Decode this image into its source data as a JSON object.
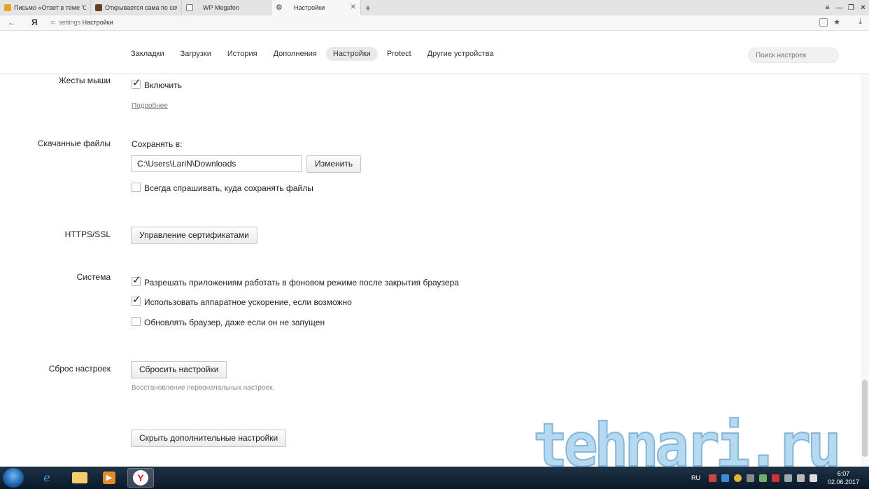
{
  "tabs": [
    {
      "title": "Письмо «Ответ в теме 'Отв",
      "favicon_color": "#e8a12a"
    },
    {
      "title": "Открывается сама по себе",
      "favicon_color": "#6b3d17"
    },
    {
      "title": "WP Megafon",
      "favicon_color": "#ffffff"
    },
    {
      "title": "Настройки",
      "favicon_color": "#555555",
      "active": true
    }
  ],
  "addressbar": {
    "logo": "Я",
    "protocol": "settings",
    "page": "Настройки"
  },
  "settings_nav": {
    "items": [
      "Закладки",
      "Загрузки",
      "История",
      "Дополнения",
      "Настройки",
      "Protect",
      "Другие устройства"
    ],
    "selected_index": 4,
    "search_placeholder": "Поиск настроек"
  },
  "mouse_gestures": {
    "label": "Жесты мыши",
    "enable": {
      "text": "Включить",
      "checked": true
    },
    "more_link": "Подробнее"
  },
  "downloads": {
    "label": "Скачанные файлы",
    "save_to": "Сохранять в:",
    "path": "C:\\Users\\LariN\\Downloads",
    "change_button": "Изменить",
    "always_ask": {
      "text": "Всегда спрашивать, куда сохранять файлы",
      "checked": false
    }
  },
  "https": {
    "label": "HTTPS/SSL",
    "button": "Управление сертификатами"
  },
  "system": {
    "label": "Система",
    "options": [
      {
        "text": "Разрешать приложениям работать в фоновом режиме после закрытия браузера",
        "checked": true
      },
      {
        "text": "Использовать аппаратное ускорение, если возможно",
        "checked": true
      },
      {
        "text": "Обновлять браузер, даже если он не запущен",
        "checked": false
      }
    ]
  },
  "reset": {
    "label": "Сброс настроек",
    "button": "Сбросить настройки",
    "hint": "Восстановление первоначальных настроек."
  },
  "hide_advanced_button": "Скрыть дополнительные настройки",
  "watermark": "tehnari.ru",
  "taskbar": {
    "lang": "RU",
    "time": "6:07",
    "date": "02.06.2017"
  },
  "colors": {
    "accent": "#e9e9e9",
    "taskbar": "#0b1a2a",
    "watermark": "#8fc3e6"
  }
}
